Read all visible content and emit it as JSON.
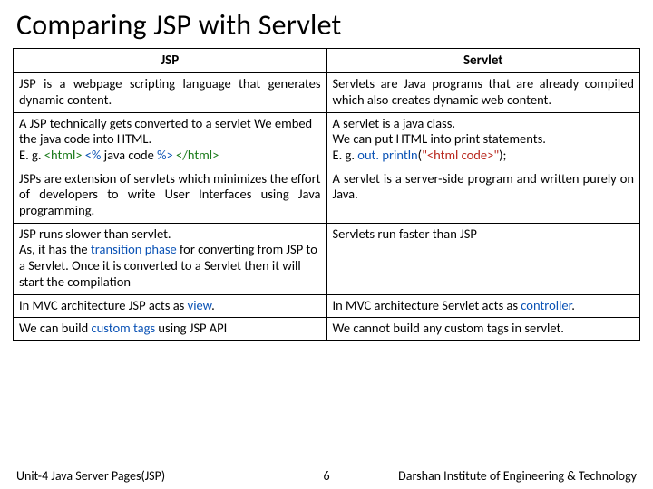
{
  "title": "Comparing JSP with Servlet",
  "headers": {
    "left": "JSP",
    "right": "Servlet"
  },
  "rows": [
    {
      "left": [
        {
          "t": "JSP is a webpage scripting language that generates dynamic content.",
          "cls": "justify"
        }
      ],
      "right": [
        {
          "t": "Servlets are Java programs that are already compiled which also creates dynamic web content.",
          "cls": "justify"
        }
      ]
    },
    {
      "left": [
        {
          "t": "A JSP technically gets converted to a servlet We embed the java code into HTML."
        },
        {
          "html": "E. g. <span class=\"green\">&lt;html&gt;</span> <span class=\"blue\">&lt;%</span> java code <span class=\"blue\">%&gt;</span> <span class=\"green\">&lt;/html&gt;</span>"
        }
      ],
      "right": [
        {
          "t": "A servlet is a java class."
        },
        {
          "t": "We can put HTML into print statements."
        },
        {
          "html": "E. g. <span class=\"blue\">out. println</span>(<span class=\"red\">\"&lt;html code&gt;\"</span>);"
        }
      ]
    },
    {
      "left": [
        {
          "t": "JSPs are extension of servlets which minimizes the effort of developers to write User Interfaces using Java programming.",
          "cls": "justify"
        }
      ],
      "right": [
        {
          "t": "A servlet is a server-side program and written purely on Java.",
          "cls": "justify"
        }
      ]
    },
    {
      "left": [
        {
          "t": "JSP runs slower than servlet."
        },
        {
          "html": "As, it has the <span class=\"blue\">transition phase</span> for converting from JSP to a Servlet. Once it is converted to a Servlet then it will start the compilation"
        }
      ],
      "right": [
        {
          "t": "Servlets run faster than JSP"
        }
      ]
    },
    {
      "left": [
        {
          "html": "In MVC architecture JSP acts as <span class=\"blue\">view</span>."
        }
      ],
      "right": [
        {
          "html": "In MVC architecture Servlet acts as <span class=\"blue\">controller</span>.",
          "cls": "justify"
        }
      ]
    },
    {
      "left": [
        {
          "html": "We can build <span class=\"blue\">custom tags</span> using JSP API"
        }
      ],
      "right": [
        {
          "t": "We cannot build any custom tags in servlet."
        }
      ]
    }
  ],
  "footer": {
    "left": "Unit-4 Java Server Pages(JSP)",
    "center": "6",
    "right": "Darshan Institute of Engineering & Technology"
  }
}
